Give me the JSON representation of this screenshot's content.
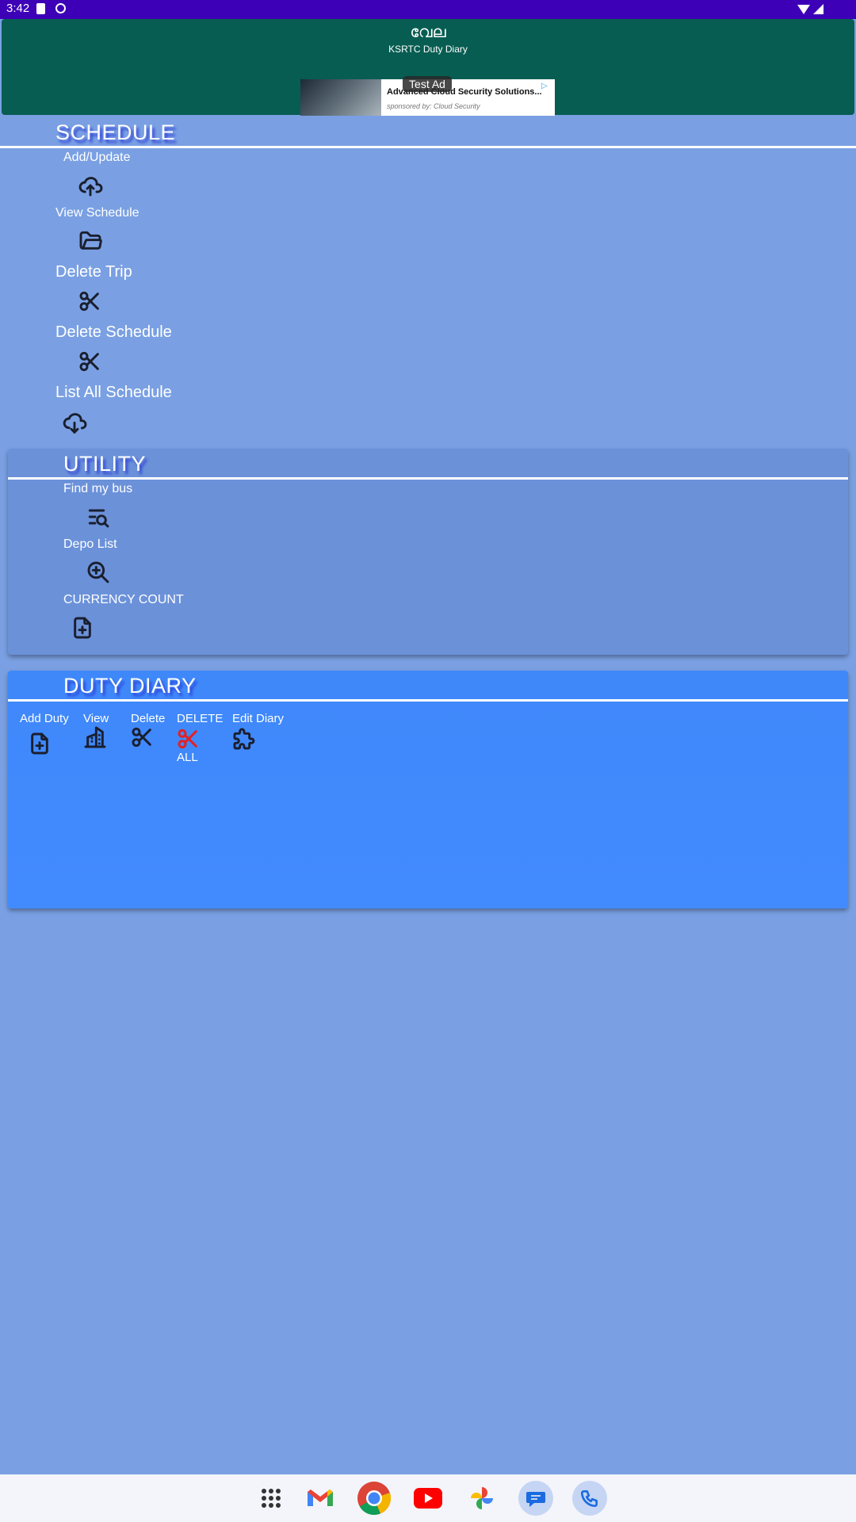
{
  "status": {
    "time": "3:42"
  },
  "app": {
    "title": "വേല",
    "subtitle": "KSRTC Duty Diary"
  },
  "ad": {
    "badge": "Test Ad",
    "headline": "Advanced Cloud Security Solutions...",
    "sponsor": "sponsored by: Cloud Security"
  },
  "schedule": {
    "title": "SCHEDULE",
    "items": [
      {
        "label": "Add/Update",
        "icon": "cloud-upload-icon"
      },
      {
        "label": "View Schedule",
        "icon": "folder-open-icon"
      },
      {
        "label": "Delete Trip",
        "icon": "scissors-icon"
      },
      {
        "label": "Delete Schedule",
        "icon": "scissors-icon"
      },
      {
        "label": "List All Schedule",
        "icon": "cloud-download-icon"
      }
    ]
  },
  "utility": {
    "title": "UTILITY",
    "items": [
      {
        "label": "Find my bus",
        "icon": "list-search-icon"
      },
      {
        "label": "Depo List",
        "icon": "zoom-in-icon"
      },
      {
        "label": "CURRENCY COUNT",
        "icon": "file-plus-icon"
      }
    ]
  },
  "diary": {
    "title": "DUTY DIARY",
    "items": [
      {
        "label": "Add Duty",
        "icon": "file-plus-icon"
      },
      {
        "label": "View",
        "icon": "building-icon"
      },
      {
        "label": "Delete",
        "icon": "scissors-icon"
      },
      {
        "label": "DELETE",
        "label2": "ALL",
        "icon": "scissors-icon",
        "color": "#e52020"
      },
      {
        "label": "Edit Diary",
        "icon": "puzzle-icon"
      }
    ]
  },
  "dock": [
    "apps-grid-icon",
    "gmail-icon",
    "chrome-icon",
    "youtube-icon",
    "photos-icon",
    "messages-icon",
    "phone-icon"
  ]
}
